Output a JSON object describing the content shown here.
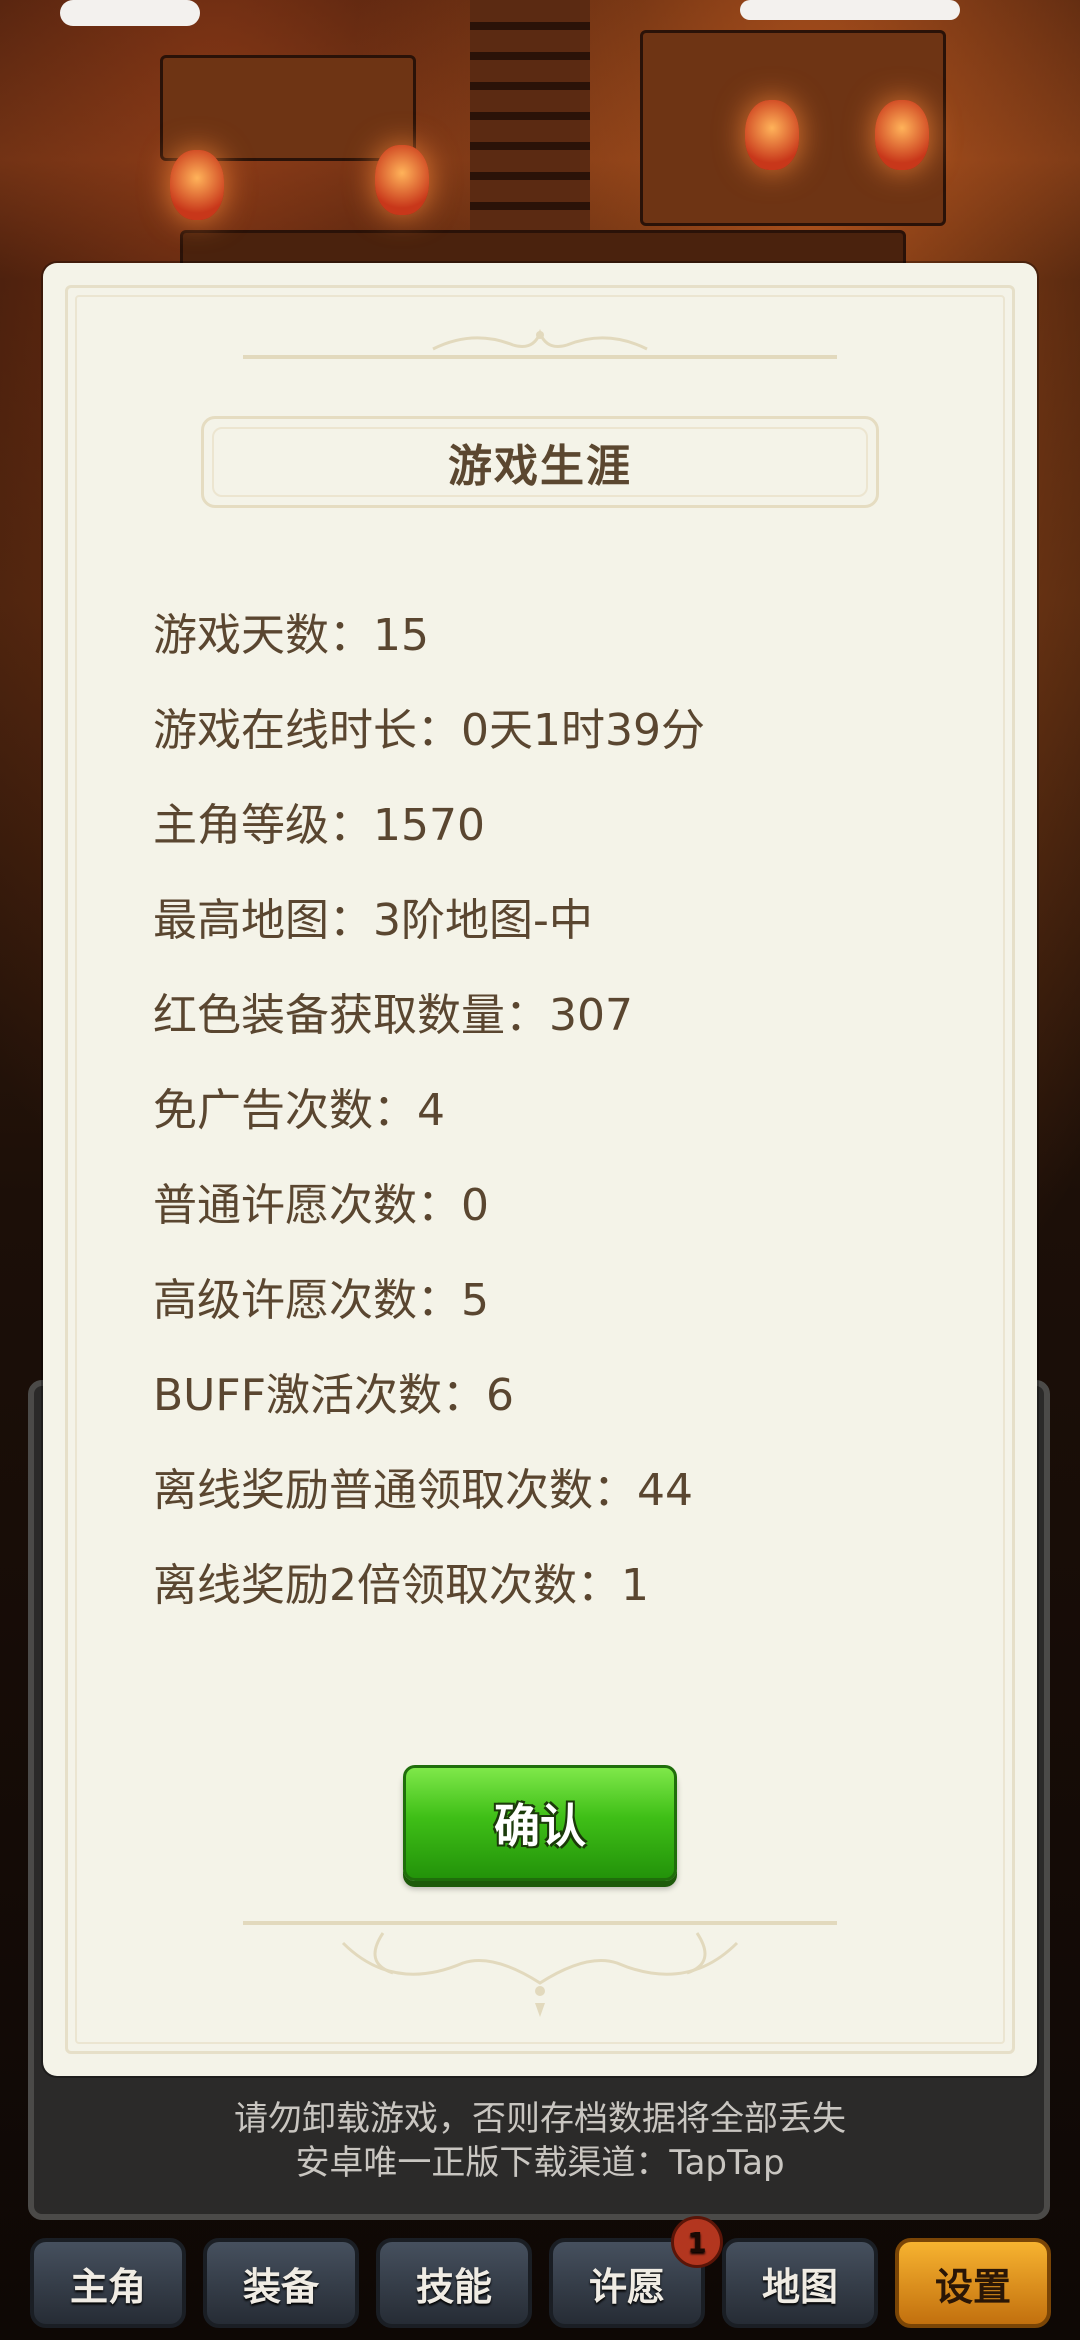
{
  "dialog": {
    "title": "游戏生涯",
    "stats": [
      "游戏天数：15",
      "游戏在线时长：0天1时39分",
      "主角等级：1570",
      "最高地图：3阶地图-中",
      "红色装备获取数量：307",
      "免广告次数：4",
      "普通许愿次数：0",
      "高级许愿次数：5",
      "BUFF激活次数：6",
      "离线奖励普通领取次数：44",
      "离线奖励2倍领取次数：1"
    ],
    "confirm_label": "确认"
  },
  "notice": {
    "line1": "请勿卸载游戏，否则存档数据将全部丢失",
    "line2": "安卓唯一正版下载渠道：TapTap"
  },
  "tabs": [
    {
      "label": "主角"
    },
    {
      "label": "装备"
    },
    {
      "label": "技能"
    },
    {
      "label": "许愿",
      "badge": "1"
    },
    {
      "label": "地图"
    },
    {
      "label": "设置",
      "active": true
    }
  ],
  "colors": {
    "modal_bg": "#f4f3e8",
    "text": "#5a4630",
    "confirm_green": "#3fbf17",
    "active_tab": "#f7b330"
  }
}
